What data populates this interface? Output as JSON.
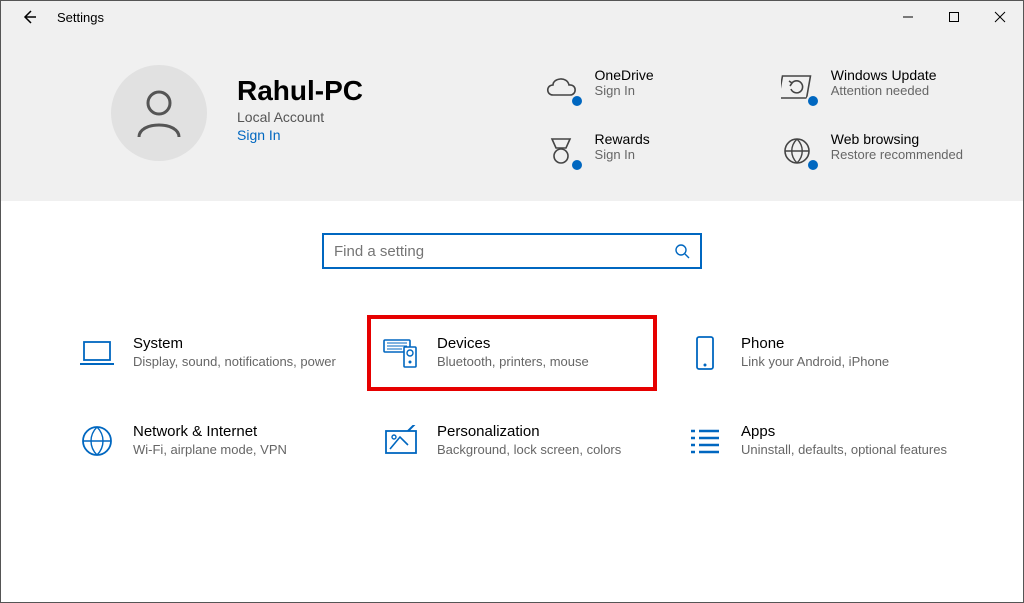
{
  "window": {
    "title": "Settings"
  },
  "user": {
    "name": "Rahul-PC",
    "account_type": "Local Account",
    "signin": "Sign In"
  },
  "quick": {
    "onedrive": {
      "title": "OneDrive",
      "sub": "Sign In"
    },
    "update": {
      "title": "Windows Update",
      "sub": "Attention needed"
    },
    "rewards": {
      "title": "Rewards",
      "sub": "Sign In"
    },
    "web": {
      "title": "Web browsing",
      "sub": "Restore recommended"
    }
  },
  "search": {
    "placeholder": "Find a setting"
  },
  "categories": {
    "system": {
      "title": "System",
      "sub": "Display, sound, notifications, power"
    },
    "devices": {
      "title": "Devices",
      "sub": "Bluetooth, printers, mouse"
    },
    "phone": {
      "title": "Phone",
      "sub": "Link your Android, iPhone"
    },
    "network": {
      "title": "Network & Internet",
      "sub": "Wi-Fi, airplane mode, VPN"
    },
    "personalization": {
      "title": "Personalization",
      "sub": "Background, lock screen, colors"
    },
    "apps": {
      "title": "Apps",
      "sub": "Uninstall, defaults, optional features"
    }
  },
  "colors": {
    "accent": "#0067c0",
    "highlight": "#e60000"
  }
}
